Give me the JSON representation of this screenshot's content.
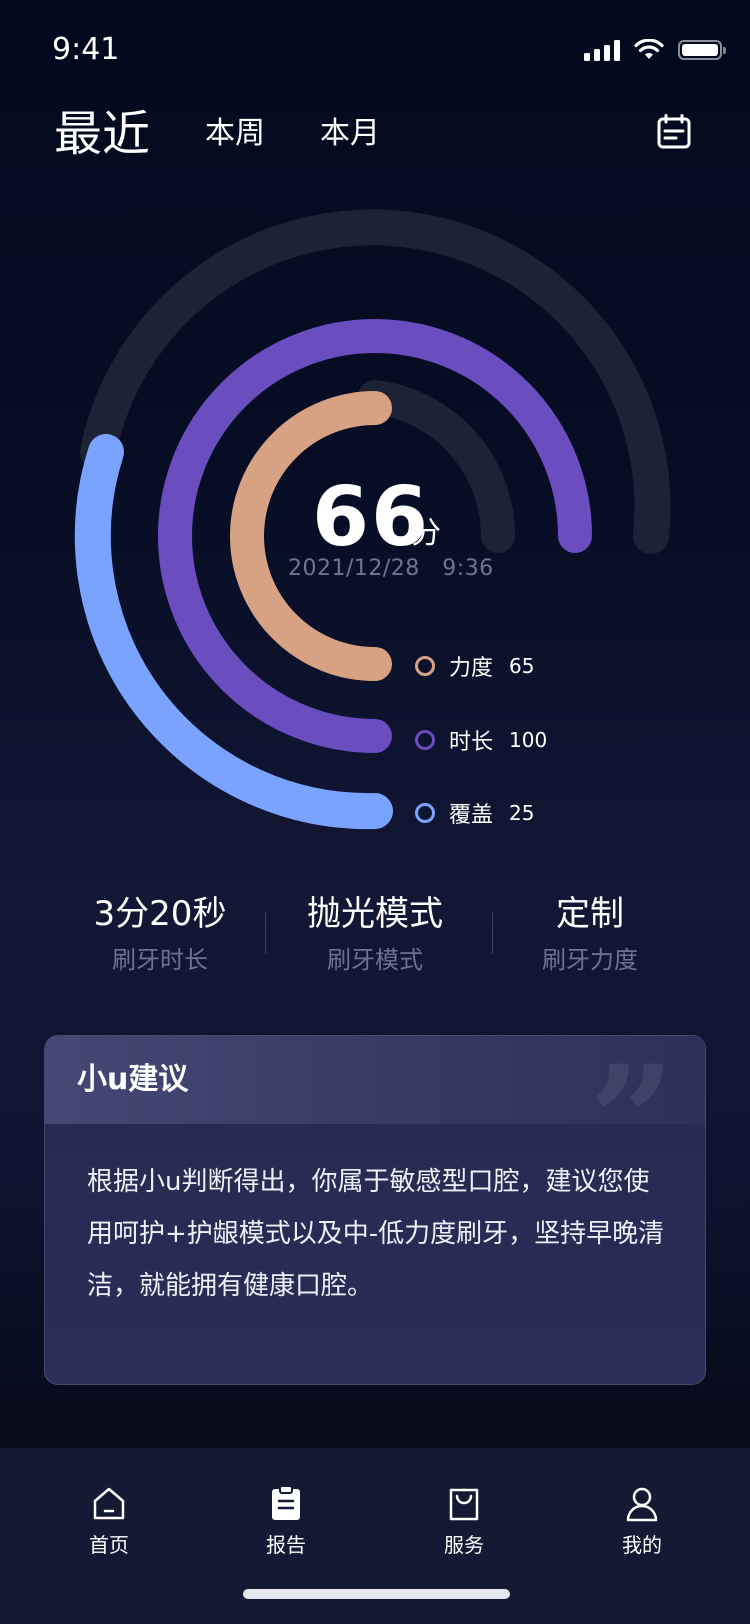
{
  "status_bar": {
    "time": "9:41"
  },
  "header": {
    "tabs": [
      {
        "label": "最近",
        "active": true
      },
      {
        "label": "本周",
        "active": false
      },
      {
        "label": "本月",
        "active": false
      }
    ],
    "calendar_icon": "calendar-icon"
  },
  "score": {
    "value": "66",
    "unit": "分",
    "datetime": "2021/12/28   9:36"
  },
  "rings": [
    {
      "label": "力度",
      "value": "65",
      "color": "#d6a283"
    },
    {
      "label": "时长",
      "value": "100",
      "color": "#6a4dbf"
    },
    {
      "label": "覆盖",
      "value": "25",
      "color": "#7aa3ff"
    }
  ],
  "track_color": "#1d2335",
  "stats": [
    {
      "value": "3分20秒",
      "label": "刷牙时长"
    },
    {
      "value": "抛光模式",
      "label": "刷牙模式"
    },
    {
      "value": "定制",
      "label": "刷牙力度"
    }
  ],
  "advice": {
    "title": "小u建议",
    "body": "根据小u判断得出，你属于敏感型口腔，建议您使用呵护+护龈模式以及中-低力度刷牙，坚持早晚清洁，就能拥有健康口腔。"
  },
  "nav": [
    {
      "label": "首页",
      "icon": "home-icon"
    },
    {
      "label": "报告",
      "icon": "report-icon"
    },
    {
      "label": "服务",
      "icon": "shopping-bag-icon"
    },
    {
      "label": "我的",
      "icon": "user-icon"
    }
  ]
}
